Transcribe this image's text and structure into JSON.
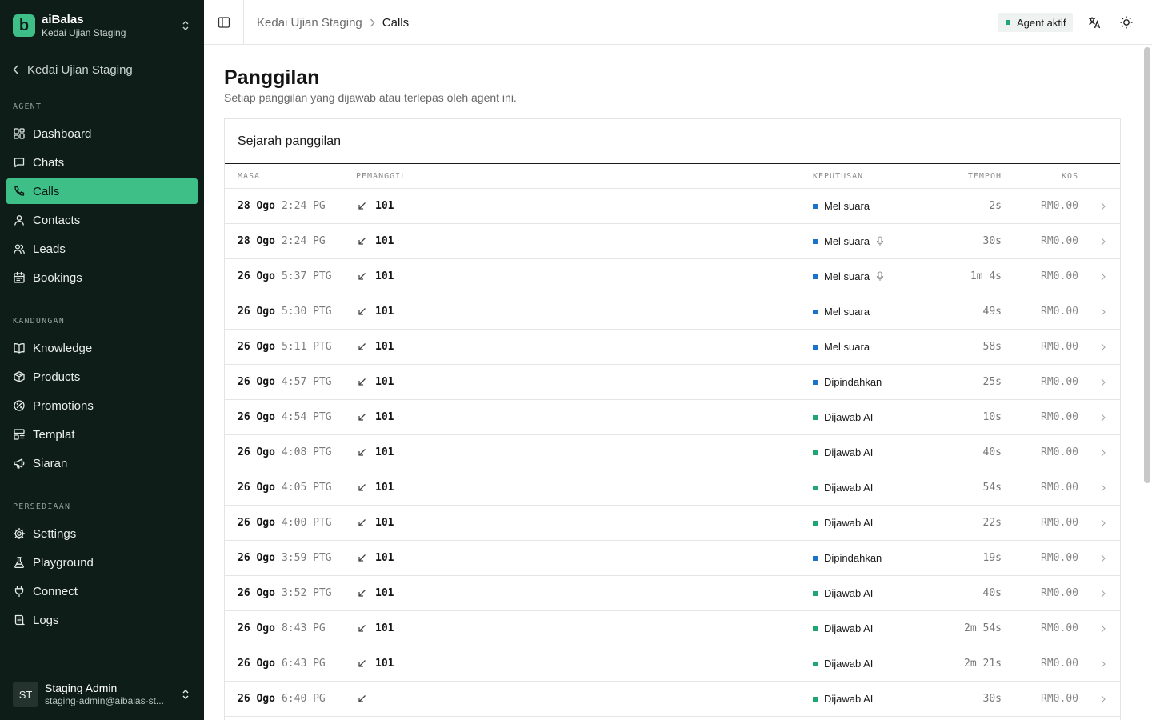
{
  "workspace": {
    "name": "aiBalas",
    "subtitle": "Kedai Ujian Staging",
    "logo_letter": "b"
  },
  "sidebar": {
    "back_label": "Kedai Ujian Staging",
    "sections": [
      {
        "label": "AGENT",
        "items": [
          {
            "label": "Dashboard",
            "icon": "dashboard-icon"
          },
          {
            "label": "Chats",
            "icon": "chat-icon"
          },
          {
            "label": "Calls",
            "icon": "phone-icon",
            "active": true
          },
          {
            "label": "Contacts",
            "icon": "contacts-icon"
          },
          {
            "label": "Leads",
            "icon": "users-icon"
          },
          {
            "label": "Bookings",
            "icon": "calendar-icon"
          }
        ]
      },
      {
        "label": "KANDUNGAN",
        "items": [
          {
            "label": "Knowledge",
            "icon": "book-icon"
          },
          {
            "label": "Products",
            "icon": "package-icon"
          },
          {
            "label": "Promotions",
            "icon": "percent-icon"
          },
          {
            "label": "Templat",
            "icon": "template-icon"
          },
          {
            "label": "Siaran",
            "icon": "megaphone-icon"
          }
        ]
      },
      {
        "label": "PERSEDIAAN",
        "items": [
          {
            "label": "Settings",
            "icon": "gear-icon"
          },
          {
            "label": "Playground",
            "icon": "flask-icon"
          },
          {
            "label": "Connect",
            "icon": "plug-icon"
          },
          {
            "label": "Logs",
            "icon": "logs-icon"
          }
        ]
      }
    ]
  },
  "user": {
    "initials": "ST",
    "name": "Staging Admin",
    "email": "staging-admin@aibalas-st..."
  },
  "topbar": {
    "breadcrumb": [
      "Kedai Ujian Staging",
      "Calls"
    ],
    "agent_status": "Agent aktif"
  },
  "page": {
    "title": "Panggilan",
    "subtitle": "Setiap panggilan yang dijawab atau terlepas oleh agent ini."
  },
  "table": {
    "card_title": "Sejarah panggilan",
    "columns": [
      "MASA",
      "PEMANGGIL",
      "KEPUTUSAN",
      "TEMPOH",
      "KOS"
    ],
    "rows": [
      {
        "date": "28 Ogo",
        "time": "2:24 PG",
        "caller": "101",
        "decision": "Mel suara",
        "status": "blue",
        "mic": false,
        "duration": "2s",
        "cost": "RM0.00"
      },
      {
        "date": "28 Ogo",
        "time": "2:24 PG",
        "caller": "101",
        "decision": "Mel suara",
        "status": "blue",
        "mic": true,
        "duration": "30s",
        "cost": "RM0.00"
      },
      {
        "date": "26 Ogo",
        "time": "5:37 PTG",
        "caller": "101",
        "decision": "Mel suara",
        "status": "blue",
        "mic": true,
        "duration": "1m 4s",
        "cost": "RM0.00"
      },
      {
        "date": "26 Ogo",
        "time": "5:30 PTG",
        "caller": "101",
        "decision": "Mel suara",
        "status": "blue",
        "mic": false,
        "duration": "49s",
        "cost": "RM0.00"
      },
      {
        "date": "26 Ogo",
        "time": "5:11 PTG",
        "caller": "101",
        "decision": "Mel suara",
        "status": "blue",
        "mic": false,
        "duration": "58s",
        "cost": "RM0.00"
      },
      {
        "date": "26 Ogo",
        "time": "4:57 PTG",
        "caller": "101",
        "decision": "Dipindahkan",
        "status": "blue",
        "mic": false,
        "duration": "25s",
        "cost": "RM0.00"
      },
      {
        "date": "26 Ogo",
        "time": "4:54 PTG",
        "caller": "101",
        "decision": "Dijawab AI",
        "status": "green",
        "mic": false,
        "duration": "10s",
        "cost": "RM0.00"
      },
      {
        "date": "26 Ogo",
        "time": "4:08 PTG",
        "caller": "101",
        "decision": "Dijawab AI",
        "status": "green",
        "mic": false,
        "duration": "40s",
        "cost": "RM0.00"
      },
      {
        "date": "26 Ogo",
        "time": "4:05 PTG",
        "caller": "101",
        "decision": "Dijawab AI",
        "status": "green",
        "mic": false,
        "duration": "54s",
        "cost": "RM0.00"
      },
      {
        "date": "26 Ogo",
        "time": "4:00 PTG",
        "caller": "101",
        "decision": "Dijawab AI",
        "status": "green",
        "mic": false,
        "duration": "22s",
        "cost": "RM0.00"
      },
      {
        "date": "26 Ogo",
        "time": "3:59 PTG",
        "caller": "101",
        "decision": "Dipindahkan",
        "status": "blue",
        "mic": false,
        "duration": "19s",
        "cost": "RM0.00"
      },
      {
        "date": "26 Ogo",
        "time": "3:52 PTG",
        "caller": "101",
        "decision": "Dijawab AI",
        "status": "green",
        "mic": false,
        "duration": "40s",
        "cost": "RM0.00"
      },
      {
        "date": "26 Ogo",
        "time": "8:43 PG",
        "caller": "101",
        "decision": "Dijawab AI",
        "status": "green",
        "mic": false,
        "duration": "2m 54s",
        "cost": "RM0.00"
      },
      {
        "date": "26 Ogo",
        "time": "6:43 PG",
        "caller": "101",
        "decision": "Dijawab AI",
        "status": "green",
        "mic": false,
        "duration": "2m 21s",
        "cost": "RM0.00"
      },
      {
        "date": "26 Ogo",
        "time": "6:40 PG",
        "caller": "",
        "decision": "Dijawab AI",
        "status": "green",
        "mic": false,
        "duration": "30s",
        "cost": "RM0.00"
      }
    ]
  },
  "colors": {
    "sidebar_bg": "#0f1d19",
    "accent": "#3fbf88",
    "status_blue": "#1a73c8",
    "status_green": "#1fa672"
  }
}
